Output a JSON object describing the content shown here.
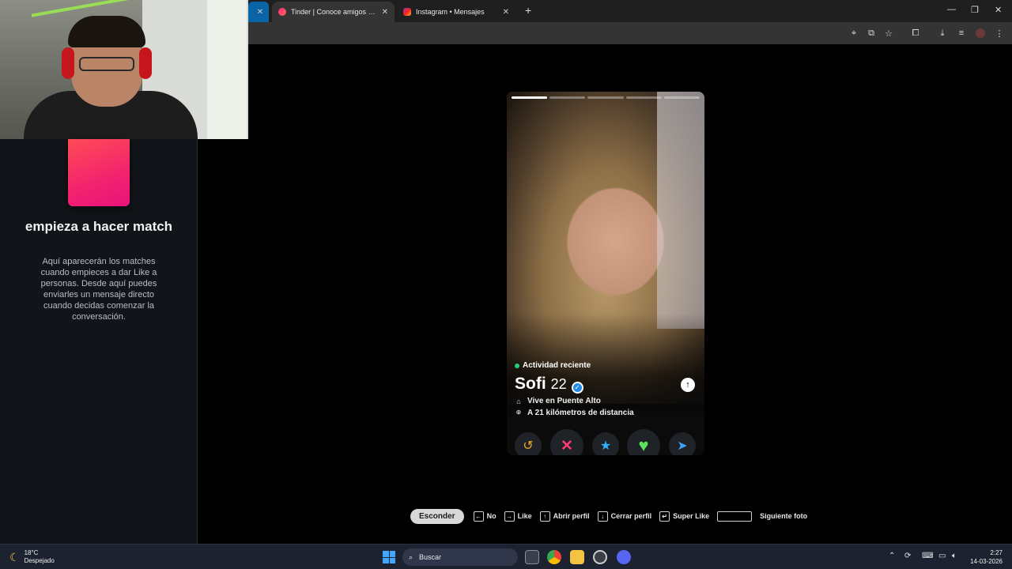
{
  "browser": {
    "tabs": [
      {
        "title": "Tinder | Conoce amigos y gente nueva",
        "active": true
      },
      {
        "title": "Instagram • Mensajes",
        "active": false
      }
    ],
    "new_tab": "+",
    "win_min": "—",
    "win_max": "❐",
    "win_close": "✕"
  },
  "sidebar": {
    "title": "empieza a hacer match",
    "description": "Aquí aparecerán los matches cuando empieces a dar Like a personas. Desde aquí puedes enviarles un mensaje directo cuando decidas comenzar la conversación."
  },
  "profile": {
    "activity": "Actividad reciente",
    "name": "Sofi",
    "age": "22",
    "lives_in": "Vive en Puente Alto",
    "distance": "A 21 kilómetros de distancia",
    "photo_count": 5,
    "current_photo": 1
  },
  "actions": {
    "rewind": "↺",
    "nope": "✕",
    "superlike": "★",
    "like": "♥",
    "boost": "➤"
  },
  "hints": {
    "hide": "Esconder",
    "no": "No",
    "like": "Like",
    "open_profile": "Abrir perfil",
    "close_profile": "Cerrar perfil",
    "super_like": "Super Like",
    "next_photo": "Siguiente foto"
  },
  "taskbar": {
    "temp": "18°C",
    "weather": "Despejado",
    "search": "Buscar",
    "time": "2:27",
    "date": "14-03-2026"
  },
  "colors": {
    "rewind": "#f5a623",
    "nope": "#fe3c72",
    "superlike": "#2db3ff",
    "like": "#5de05a",
    "boost": "#3ba5f5"
  }
}
